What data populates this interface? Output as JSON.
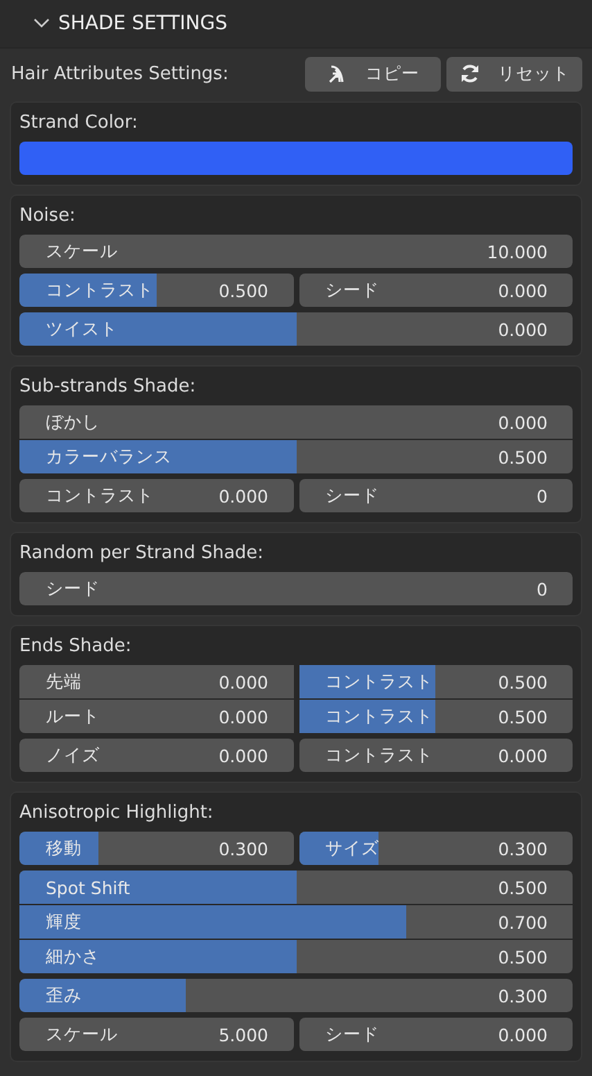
{
  "header": {
    "title": "SHADE SETTINGS",
    "expanded": true
  },
  "attributes": {
    "label": "Hair Attributes Settings:",
    "buttons": [
      {
        "kind": "copy",
        "label": "コピー"
      },
      {
        "kind": "reset",
        "label": "リセット"
      }
    ]
  },
  "strand_color": {
    "title": "Strand Color:",
    "color": "#3060f5"
  },
  "sections": [
    {
      "title": "Noise:",
      "groups": [
        [
          [
            {
              "label": "スケール",
              "value": "10.000"
            }
          ]
        ],
        [
          [
            {
              "label": "コントラスト",
              "value": "0.500",
              "level": 0.5
            },
            {
              "label": "シード",
              "value": "0.000"
            }
          ]
        ],
        [
          [
            {
              "label": "ツイスト",
              "value": "0.000",
              "level": 0.5
            }
          ]
        ]
      ]
    },
    {
      "title": "Sub-strands Shade:",
      "groups": [
        [
          [
            {
              "label": "ぼかし",
              "value": "0.000"
            }
          ],
          [
            {
              "label": "カラーバランス",
              "value": "0.500",
              "level": 0.5
            }
          ]
        ],
        [
          [
            {
              "label": "コントラスト",
              "value": "0.000"
            },
            {
              "label": "シード",
              "value": "0"
            }
          ]
        ]
      ]
    },
    {
      "title": "Random per Strand Shade:",
      "groups": [
        [
          [
            {
              "label": "シード",
              "value": "0"
            }
          ]
        ]
      ]
    },
    {
      "title": "Ends Shade:",
      "groups": [
        [
          [
            {
              "label": "先端",
              "value": "0.000"
            },
            {
              "label": "コントラスト",
              "value": "0.500",
              "level": 0.5
            }
          ],
          [
            {
              "label": "ルート",
              "value": "0.000"
            },
            {
              "label": "コントラスト",
              "value": "0.500",
              "level": 0.5
            }
          ]
        ],
        [
          [
            {
              "label": "ノイズ",
              "value": "0.000"
            },
            {
              "label": "コントラスト",
              "value": "0.000"
            }
          ]
        ]
      ]
    },
    {
      "title": "Anisotropic Highlight:",
      "groups": [
        [
          [
            {
              "label": "移動",
              "value": "0.300",
              "level": 0.29
            },
            {
              "label": "サイズ",
              "value": "0.300",
              "level": 0.29
            }
          ]
        ],
        [
          [
            {
              "label": "Spot Shift",
              "value": "0.500",
              "level": 0.5
            }
          ],
          [
            {
              "label": "輝度",
              "value": "0.700",
              "level": 0.7
            }
          ],
          [
            {
              "label": "細かさ",
              "value": "0.500",
              "level": 0.5
            }
          ]
        ],
        [
          [
            {
              "label": "歪み",
              "value": "0.300",
              "level": 0.3
            }
          ]
        ],
        [
          [
            {
              "label": "スケール",
              "value": "5.000"
            },
            {
              "label": "シード",
              "value": "0.000"
            }
          ]
        ]
      ]
    }
  ]
}
